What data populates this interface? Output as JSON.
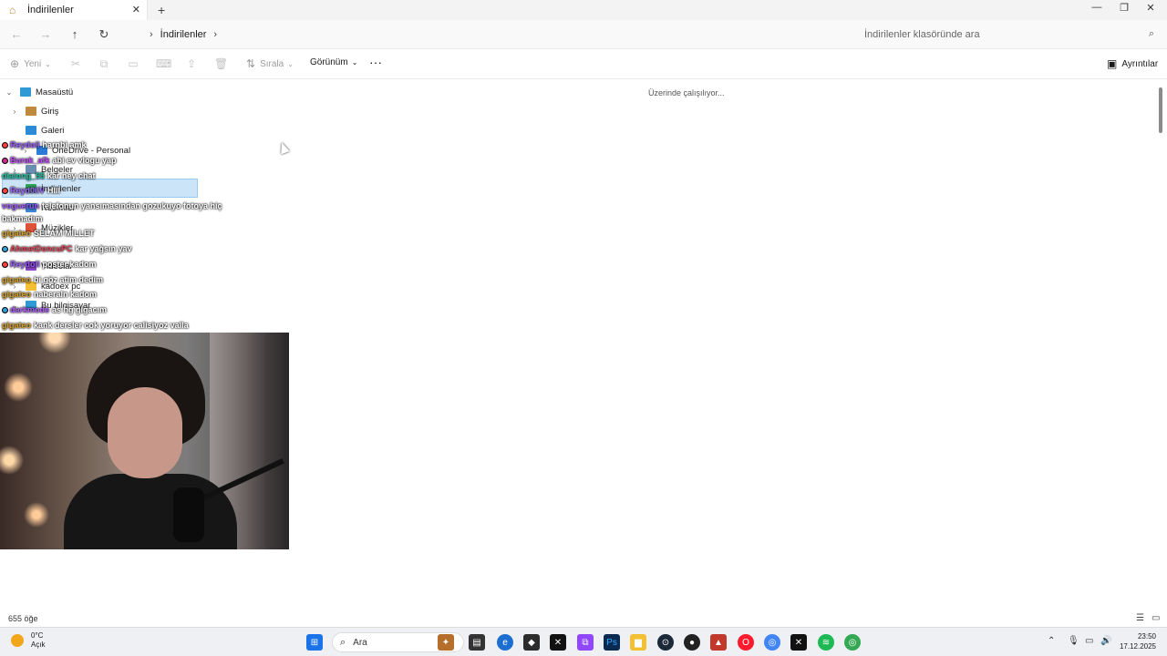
{
  "tab": {
    "title": "İndirilenler",
    "close": "✕",
    "new": "+"
  },
  "window": {
    "minimize": "—",
    "maximize": "❐",
    "close": "✕"
  },
  "nav": {
    "back": "←",
    "forward": "→",
    "up": "↑",
    "refresh": "↻"
  },
  "address": {
    "separator": "›",
    "crumb": "İndirilenler",
    "trailing": "›"
  },
  "search": {
    "placeholder": "İndirilenler klasöründe ara",
    "icon": "search-icon"
  },
  "commands": {
    "new": "Yeni",
    "sort": "Sırala",
    "view": "Görünüm",
    "more": "···",
    "details": "Ayrıntılar"
  },
  "tree": [
    {
      "label": "Masaüstü",
      "expand": "⌄",
      "color": "#2f9ad3"
    },
    {
      "label": "Giriş",
      "expand": "›",
      "color": "#c08a3e"
    },
    {
      "label": "Galeri",
      "expand": "",
      "color": "#2b8bd6"
    },
    {
      "label": "OneDrive - Personal",
      "expand": "›",
      "color": "#2b7bd6"
    },
    {
      "label": "Belgeler",
      "expand": "›",
      "color": "#6b8fb3"
    },
    {
      "label": "İndirilenler",
      "expand": "›",
      "color": "#2fa65a"
    },
    {
      "label": "Resimler",
      "expand": "›",
      "color": "#3f86d6"
    },
    {
      "label": "Müzikler",
      "expand": "›",
      "color": "#e0533b"
    },
    {
      "label": "Videolar",
      "expand": "›",
      "color": "#8a46c4"
    },
    {
      "label": "kadoex pc",
      "expand": "›",
      "color": "#f3c033"
    },
    {
      "label": "Bu bilgisayar",
      "expand": "⌄",
      "color": "#2f9ad3"
    }
  ],
  "main": {
    "working": "Üzerinde çalışılıyor..."
  },
  "chat": [
    {
      "user": "Reydoil",
      "msg": "harnbi amk",
      "color": "#9a5cff",
      "badge": "#ff4040"
    },
    {
      "user": "Burak_afk",
      "msg": "abi ev vlogu yap",
      "color": "#c04cff",
      "badge": "#cc2b8a"
    },
    {
      "user": "dialong_55",
      "msg": "kar ney chat",
      "color": "#19c2a5",
      "badge": ""
    },
    {
      "user": "Reyd0ilV",
      "msg": "HIII",
      "color": "#a46bff",
      "badge": "#ff4040"
    },
    {
      "user": "voguerun",
      "msg": "telefonun yansımasından gozukuyo fotoya hiç",
      "color": "#a05cff",
      "badge": ""
    },
    {
      "user": "",
      "msg": "bakmadım",
      "color": "#ffffff",
      "badge": ""
    },
    {
      "user": "gigateo",
      "msg": "SELAM MILLET",
      "color": "#d6a12b",
      "badge": ""
    },
    {
      "user": "AhmetDoncuPC",
      "msg": "kar yağsın yav",
      "color": "#e0455b",
      "badge": "#2ea0d8"
    },
    {
      "user": "Reydoil",
      "msg": "poster kadom",
      "color": "#9a5cff",
      "badge": "#ff4040"
    },
    {
      "user": "gigateo",
      "msg": "bi göz atim dedim",
      "color": "#d6a12b",
      "badge": ""
    },
    {
      "user": "gigateo",
      "msg": "naberaln kadom",
      "color": "#d6a12b",
      "badge": ""
    },
    {
      "user": "darkmode",
      "msg": "as hg gigacım",
      "color": "#b05cff",
      "badge": "#2ea0d8"
    },
    {
      "user": "gigateo",
      "msg": "kank dersler cok yoruyor calisiyoz valla",
      "color": "#d6a12b",
      "badge": ""
    }
  ],
  "status": {
    "count": "655 öğe"
  },
  "taskbar": {
    "temp": "0°C",
    "condition": "Açık",
    "search": "Ara",
    "time": "23:50",
    "date": "17.12.2025"
  }
}
